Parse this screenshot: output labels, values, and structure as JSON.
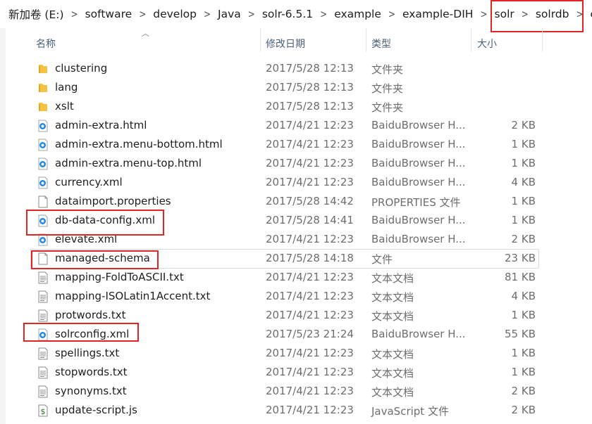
{
  "breadcrumb": [
    "新加卷 (E:)",
    "software",
    "develop",
    "Java",
    "solr-6.5.1",
    "example",
    "example-DIH",
    "solr",
    "solrdb",
    "conf"
  ],
  "columns": {
    "name": "名称",
    "date": "修改日期",
    "type": "类型",
    "size": "大小"
  },
  "files": [
    {
      "name": "clustering",
      "date": "2017/5/28 12:13",
      "type": "文件夹",
      "size": "",
      "icon": "folder-icon"
    },
    {
      "name": "lang",
      "date": "2017/5/28 12:13",
      "type": "文件夹",
      "size": "",
      "icon": "folder-icon"
    },
    {
      "name": "xslt",
      "date": "2017/5/28 12:13",
      "type": "文件夹",
      "size": "",
      "icon": "folder-icon"
    },
    {
      "name": "admin-extra.html",
      "date": "2017/4/21 12:23",
      "type": "BaiduBrowser H...",
      "size": "2 KB",
      "icon": "baidu-browser-icon"
    },
    {
      "name": "admin-extra.menu-bottom.html",
      "date": "2017/4/21 12:23",
      "type": "BaiduBrowser H...",
      "size": "1 KB",
      "icon": "baidu-browser-icon"
    },
    {
      "name": "admin-extra.menu-top.html",
      "date": "2017/4/21 12:23",
      "type": "BaiduBrowser H...",
      "size": "1 KB",
      "icon": "baidu-browser-icon"
    },
    {
      "name": "currency.xml",
      "date": "2017/4/21 12:23",
      "type": "BaiduBrowser H...",
      "size": "4 KB",
      "icon": "baidu-browser-icon"
    },
    {
      "name": "dataimport.properties",
      "date": "2017/5/28 14:42",
      "type": "PROPERTIES 文件",
      "size": "1 KB",
      "icon": "file-icon"
    },
    {
      "name": "db-data-config.xml",
      "date": "2017/5/28 14:41",
      "type": "BaiduBrowser H...",
      "size": "1 KB",
      "icon": "baidu-browser-icon"
    },
    {
      "name": "elevate.xml",
      "date": "2017/4/21 12:23",
      "type": "BaiduBrowser H...",
      "size": "2 KB",
      "icon": "baidu-browser-icon"
    },
    {
      "name": "managed-schema",
      "date": "2017/5/28 14:18",
      "type": "文件",
      "size": "23 KB",
      "icon": "file-icon"
    },
    {
      "name": "mapping-FoldToASCII.txt",
      "date": "2017/4/21 12:23",
      "type": "文本文档",
      "size": "81 KB",
      "icon": "text-file-icon"
    },
    {
      "name": "mapping-ISOLatin1Accent.txt",
      "date": "2017/4/21 12:23",
      "type": "文本文档",
      "size": "4 KB",
      "icon": "text-file-icon"
    },
    {
      "name": "protwords.txt",
      "date": "2017/4/21 12:23",
      "type": "文本文档",
      "size": "1 KB",
      "icon": "text-file-icon"
    },
    {
      "name": "solrconfig.xml",
      "date": "2017/5/23 21:24",
      "type": "BaiduBrowser H...",
      "size": "55 KB",
      "icon": "baidu-browser-icon"
    },
    {
      "name": "spellings.txt",
      "date": "2017/4/21 12:23",
      "type": "文本文档",
      "size": "1 KB",
      "icon": "text-file-icon"
    },
    {
      "name": "stopwords.txt",
      "date": "2017/4/21 12:23",
      "type": "文本文档",
      "size": "1 KB",
      "icon": "text-file-icon"
    },
    {
      "name": "synonyms.txt",
      "date": "2017/4/21 12:23",
      "type": "文本文档",
      "size": "2 KB",
      "icon": "text-file-icon"
    },
    {
      "name": "update-script.js",
      "date": "2017/4/21 12:23",
      "type": "JavaScript 文件",
      "size": "2 KB",
      "icon": "javascript-file-icon"
    }
  ],
  "colors": {
    "highlight": "#e02525",
    "header_text": "#4c607a",
    "folder": "#f5c242",
    "baidu": "#1e88e5"
  }
}
